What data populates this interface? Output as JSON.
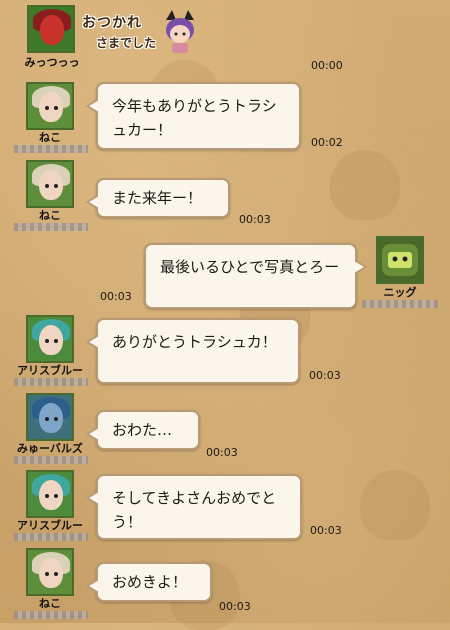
{
  "background_color": "#c9a26a",
  "bubble_color": "#fbf6ec",
  "stamp": {
    "line1": "おつかれ",
    "line2": "さまでした",
    "icon": "cat-ear-chibi-icon"
  },
  "messages": [
    {
      "sender": "みっつっっ",
      "text": "",
      "time": "00:00",
      "avatar": "red-demon-avatar"
    },
    {
      "sender": "ねこ",
      "text": "今年もありがとうトラシュカー！",
      "time": "00:02",
      "avatar": "blonde-girl-avatar"
    },
    {
      "sender": "ねこ",
      "text": "また来年ー！",
      "time": "00:03",
      "avatar": "blonde-girl-avatar"
    },
    {
      "sender": "ニッグ",
      "text": "最後いるひとで写真とろー",
      "time": "00:03",
      "avatar": "green-robot-avatar"
    },
    {
      "sender": "アリスブルー",
      "text": "ありがとうトラシュカ！",
      "time": "00:03",
      "avatar": "teal-hat-girl-avatar"
    },
    {
      "sender": "みゅーバルズ",
      "text": "おわた…",
      "time": "00:03",
      "avatar": "blue-hair-avatar"
    },
    {
      "sender": "アリスブルー",
      "text": "そしてきよさんおめでとう！",
      "time": "00:03",
      "avatar": "teal-hat-girl-avatar"
    },
    {
      "sender": "ねこ",
      "text": "おめきよ！",
      "time": "00:03",
      "avatar": "blonde-girl-avatar"
    }
  ]
}
